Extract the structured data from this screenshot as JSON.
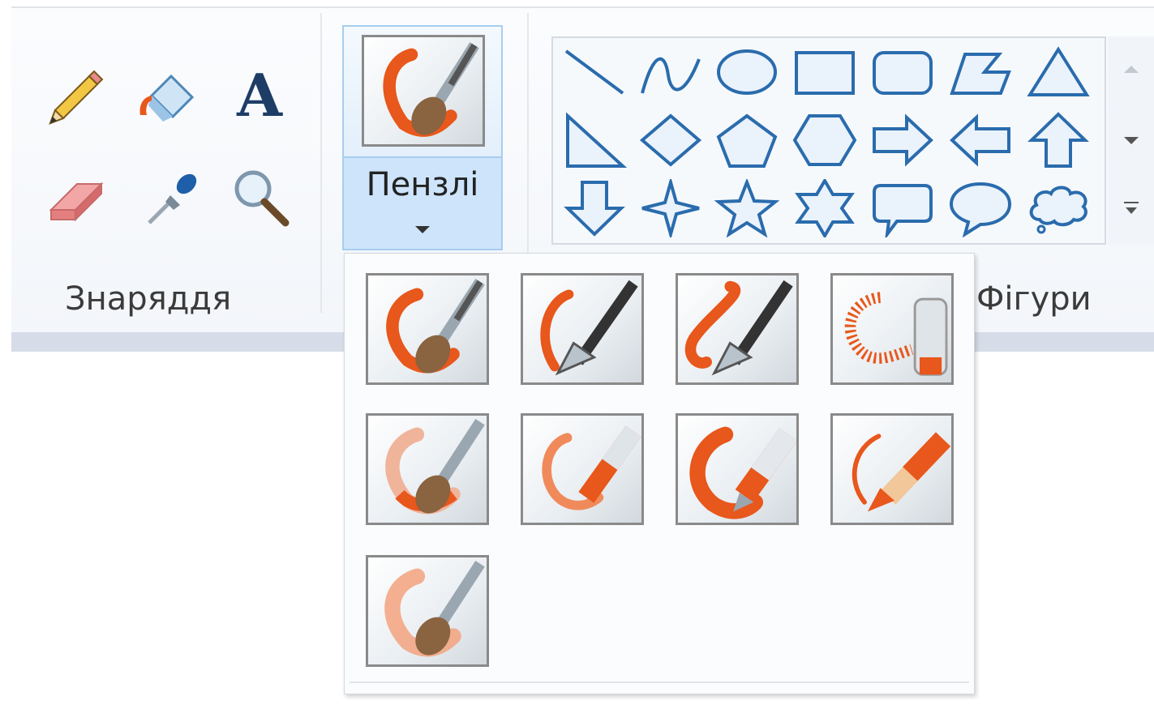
{
  "tools_group": {
    "label": "Знаряддя",
    "tools": [
      {
        "name": "pencil-icon"
      },
      {
        "name": "fill-bucket-icon"
      },
      {
        "name": "text-icon",
        "glyph": "A"
      },
      {
        "name": "eraser-icon"
      },
      {
        "name": "color-picker-icon"
      },
      {
        "name": "magnifier-icon"
      }
    ]
  },
  "brushes": {
    "label": "Пензлі",
    "options": [
      {
        "name": "brush"
      },
      {
        "name": "calligraphy-brush-1"
      },
      {
        "name": "calligraphy-brush-2"
      },
      {
        "name": "airbrush"
      },
      {
        "name": "oil-brush"
      },
      {
        "name": "crayon"
      },
      {
        "name": "marker"
      },
      {
        "name": "natural-pencil"
      },
      {
        "name": "watercolor-brush"
      }
    ]
  },
  "shapes_group": {
    "label": "Фігури",
    "shapes": [
      "line",
      "curve",
      "oval",
      "rectangle",
      "rounded-rectangle",
      "polygon",
      "triangle",
      "right-triangle",
      "diamond",
      "pentagon",
      "hexagon",
      "right-arrow",
      "left-arrow",
      "up-arrow",
      "down-arrow",
      "four-point-star",
      "five-point-star",
      "six-point-star",
      "rounded-callout",
      "oval-callout",
      "cloud-callout"
    ]
  },
  "colors": {
    "shape_stroke": "#2a6cad",
    "accent": "#e8571b",
    "button_border": "#a7cdf0"
  }
}
